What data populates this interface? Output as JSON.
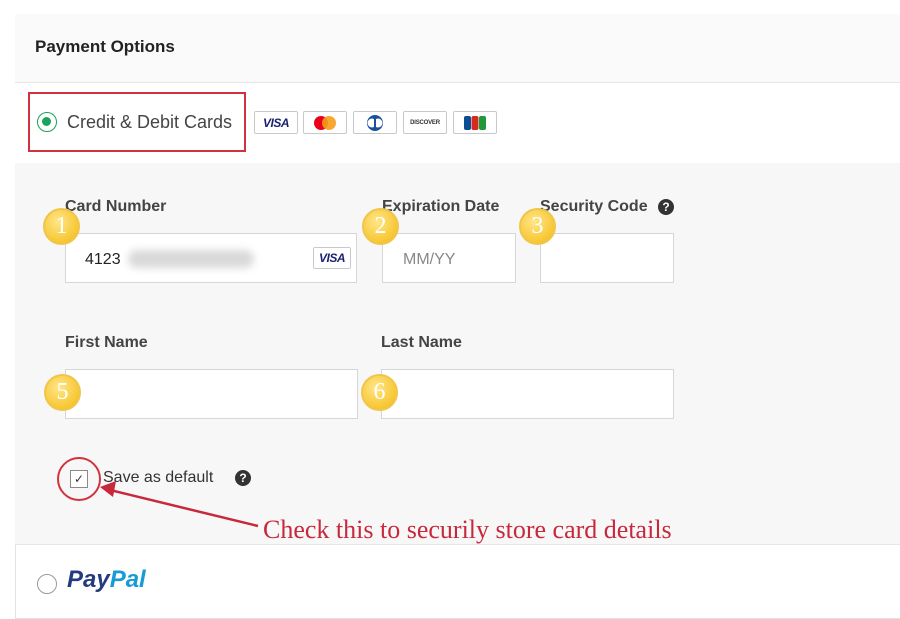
{
  "header": {
    "title": "Payment Options"
  },
  "methods": {
    "credit": {
      "label": "Credit & Debit Cards",
      "selected": true
    },
    "paypal": {
      "part1": "Pay",
      "part2": "Pal",
      "selected": false
    }
  },
  "card_logos": [
    {
      "name": "visa",
      "text": "VISA"
    },
    {
      "name": "mastercard",
      "text": ""
    },
    {
      "name": "diners",
      "text": ""
    },
    {
      "name": "discover",
      "text": "DISCOVER"
    },
    {
      "name": "jcb",
      "text": ""
    }
  ],
  "form": {
    "card_number": {
      "label": "Card Number",
      "value_visible": "4123",
      "brand": "VISA"
    },
    "expiration": {
      "label": "Expiration Date",
      "placeholder": "MM/YY"
    },
    "security": {
      "label": "Security Code",
      "help": "?"
    },
    "first_name": {
      "label": "First Name",
      "value": ""
    },
    "last_name": {
      "label": "Last Name",
      "value": ""
    },
    "save_default": {
      "label": "Save as default",
      "checked": true,
      "check_mark": "✓",
      "help": "?"
    }
  },
  "annotations": {
    "badges": [
      "1",
      "2",
      "3",
      "5",
      "6"
    ],
    "note": "Check this to securily store card details",
    "accent_color": "#c8283c"
  }
}
